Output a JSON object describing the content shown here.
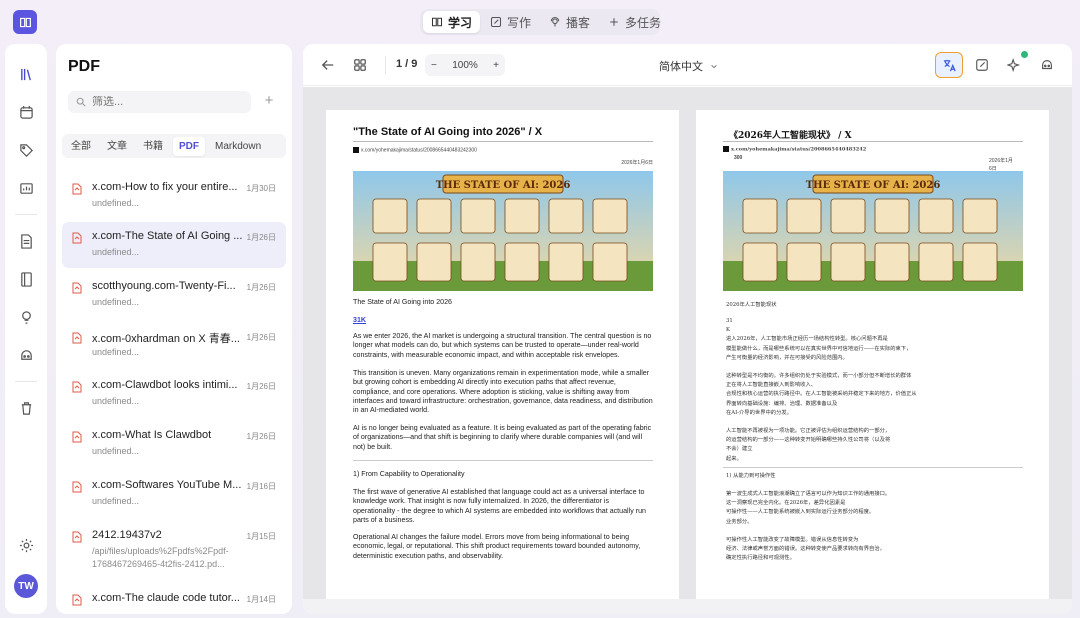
{
  "top_nav": {
    "tabs": [
      {
        "label": "学习",
        "icon": "book-icon",
        "active": true
      },
      {
        "label": "写作",
        "icon": "pen-icon",
        "active": false
      },
      {
        "label": "播客",
        "icon": "podcast-icon",
        "active": false
      },
      {
        "label": "多任务",
        "icon": "plus-icon",
        "active": false
      }
    ]
  },
  "sidebar_icons": [
    "library-icon",
    "calendar-icon",
    "tag-icon",
    "chart-icon",
    "document-icon",
    "notebook-icon",
    "lightbulb-icon",
    "robot-icon",
    "trash-icon",
    "settings-icon"
  ],
  "user": {
    "initials": "TW"
  },
  "list_panel": {
    "title": "PDF",
    "search_placeholder": "筛选...",
    "add_label": "+",
    "filters": [
      {
        "label": "全部",
        "active": false
      },
      {
        "label": "文章",
        "active": false
      },
      {
        "label": "书籍",
        "active": false
      },
      {
        "label": "PDF",
        "active": true
      },
      {
        "label": "Markdown",
        "active": false
      }
    ],
    "items": [
      {
        "title": "x.com-How to fix your entire...",
        "date": "1月30日",
        "subtitle": "undefined...",
        "active": false
      },
      {
        "title": "x.com-The State of AI Going ...",
        "date": "1月26日",
        "subtitle": "undefined...",
        "active": true
      },
      {
        "title": "scotthyoung.com-Twenty-Fi...",
        "date": "1月26日",
        "subtitle": "undefined...",
        "active": false
      },
      {
        "title": "x.com-0xhardman on X 青春...",
        "date": "1月26日",
        "subtitle": "undefined...",
        "active": false
      },
      {
        "title": "x.com-Clawdbot looks intimi...",
        "date": "1月26日",
        "subtitle": "undefined...",
        "active": false
      },
      {
        "title": "x.com-What Is Clawdbot",
        "date": "1月26日",
        "subtitle": "undefined...",
        "active": false
      },
      {
        "title": "x.com-Softwares YouTube M...",
        "date": "1月16日",
        "subtitle": "undefined...",
        "active": false
      },
      {
        "title": "2412.19437v2",
        "date": "1月15日",
        "subtitle": "/api/files/uploads%2Fpdfs%2Fpdf-",
        "subtitle2": "1768467269465-4t2fis-2412.pd...",
        "active": false
      },
      {
        "title": "x.com-The claude code tutor...",
        "date": "1月14日",
        "subtitle": "",
        "active": false
      }
    ]
  },
  "viewer": {
    "page_indicator": "1 / 9",
    "zoom": "100%",
    "zoom_minus": "−",
    "zoom_plus": "+",
    "language": "简体中文",
    "pages": {
      "left": {
        "title": "\"The State of AI Going into 2026\" / X",
        "url": "x.com/yohemakajima/status/2008665440483242300",
        "date": "2026年1月6日",
        "banner_title": "THE STATE OF AI: 2026",
        "subtitle": "The State of AI Going into 2026",
        "link": "31K",
        "paragraphs": [
          "As we enter 2026, the AI market is undergoing a structural transition. The central question is no longer what models can do, but which systems can be trusted to operate—under real-world constraints, with measurable economic impact, and within acceptable risk envelopes.",
          "This transition is uneven. Many organizations remain in experimentation mode, while a smaller but growing cohort is embedding AI directly into execution paths that affect revenue, compliance, and core operations. Where adoption is sticking, value is shifting away from interfaces and toward infrastructure: orchestration, governance, data readiness, and distribution in an AI-mediated world.",
          "AI is no longer being evaluated as a feature. It is being evaluated as part of the operating fabric of organizations—and that shift is beginning to clarify where durable companies will (and will not) be built."
        ],
        "section": "1) From Capability to Operationality",
        "paragraphs2": [
          "The first wave of generative AI established that language could act as a universal interface to knowledge work. That insight is now fully internalized. In 2026, the differentiator is operationality - the degree to which AI systems are embedded into workflows that actually run parts of a business.",
          "Operational AI changes the failure model. Errors move from being informational to being economic, legal, or reputational. This shift product requirements toward bounded autonomy, deterministic execution paths, and observability."
        ]
      },
      "right": {
        "title": "《2026年人工智能现状》 / X",
        "url": "x.com/yohemakajima/status/2008665440483242",
        "url2": "300",
        "date": "2026年1月",
        "date2": "6日",
        "banner_title": "THE STATE OF AI: 2026",
        "subtitle": "2026年人工智能现状",
        "lines_a": [
          "31",
          "K",
          "进入2026年，人工智能市场正经历一场结构性转型。核心问题不再是",
          "模型能做什么，而是哪些系统可以在真实世界中可信地运行——在实际的束下，",
          "产生可衡量的经济影响，并在可接受的风险范围内。"
        ],
        "lines_b": [
          "这种转型是不均衡的。许多组织仍处于实验模式，而一小部分但不断增长的群体",
          "正在将人工智能直接嵌入到影响收入、",
          "合规性和核心运营的执行路径中。在人工智能被采纳并稳定下来的地方，价值正从",
          "界面转向基础设施：编排、治理、数据准备以及",
          "在AI-介导的世界中的分发。"
        ],
        "lines_c": [
          "人工智能不再被视为一项功能。它正被评估为组织运营结构的一部分，",
          "的运营结构的一部分——这种转变开始明确哪些持久性公司将（以及将",
          "不会）建立",
          "起来。"
        ],
        "section": "1) 从能力到可操作性",
        "lines_d": [
          "第一波生成式人工智能浪潮确立了语言可以作为知识工作的通用接口。",
          "这一洞察现已完全内化。在2026年，差异化因素是",
          "可操作性——人工智能系统被嵌入到实际运行业务部分的程度。",
          "业务部分。"
        ],
        "lines_e": [
          "可操作性人工智能改变了故障模型。错误从信息性转变为",
          "经济、法律或声誉方面的错误。这种转变使产品要求转向有界自治，",
          "确定性执行路径和可观测性。"
        ]
      }
    }
  }
}
